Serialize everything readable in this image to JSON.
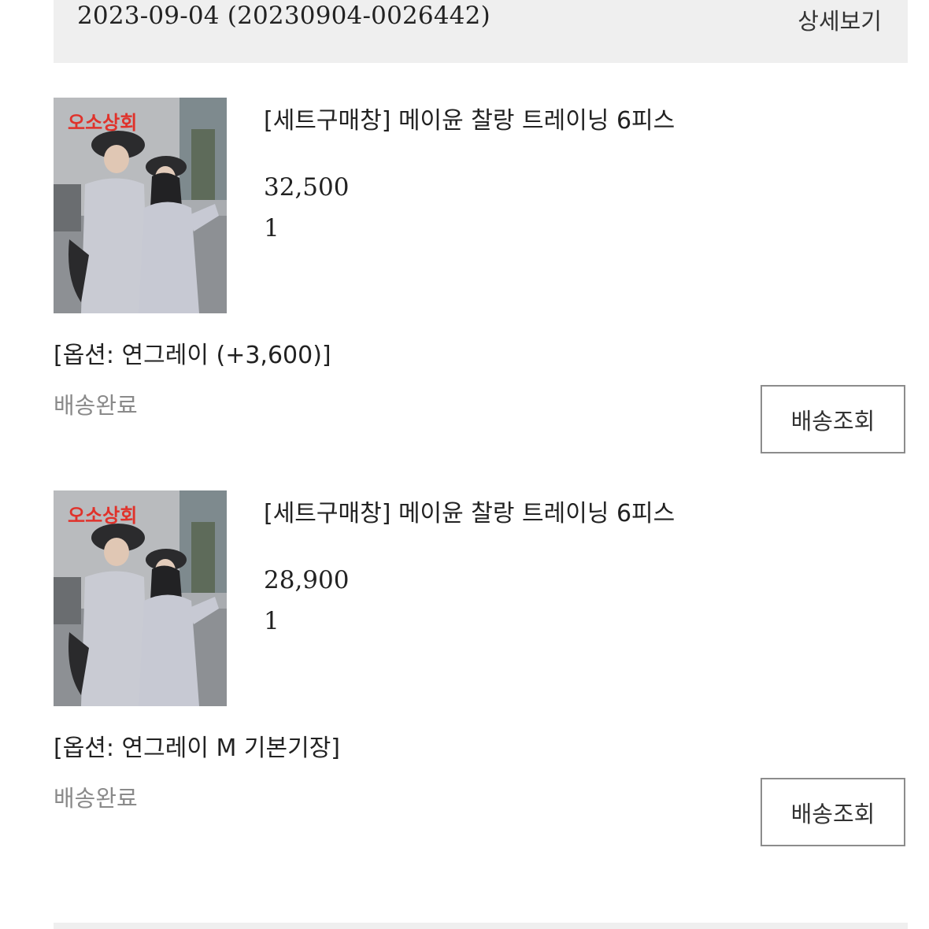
{
  "order": {
    "date_label": "2023-09-04 (20230904-0026442)",
    "detail_label": "상세보기"
  },
  "items": [
    {
      "image_text": "오소상회",
      "name": "[세트구매창] 메이윤 찰랑 트레이닝 6피스",
      "price": "32,500",
      "quantity": "1",
      "option": "[옵션: 연그레이 (+3,600)]",
      "status": "배송완료",
      "track_label": "배송조회"
    },
    {
      "image_text": "오소상회",
      "name": "[세트구매창] 메이윤 찰랑 트레이닝 6피스",
      "price": "28,900",
      "quantity": "1",
      "option": "[옵션: 연그레이 M 기본기장]",
      "status": "배송완료",
      "track_label": "배송조회"
    }
  ],
  "colors": {
    "header_bg": "#efefef",
    "status_text": "#8a8a8a",
    "button_border": "#8c8c8c",
    "logo_text": "#e0322b"
  }
}
